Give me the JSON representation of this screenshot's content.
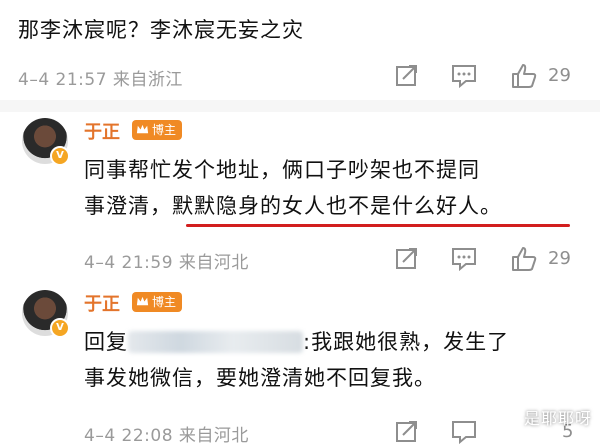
{
  "top_comment": {
    "text": "那李沐宸呢？李沐宸无妄之灾"
  },
  "row1": {
    "meta": "4–4 21:57  来自浙江",
    "likes": "29"
  },
  "reply1": {
    "user": "于正",
    "badge": "博主",
    "text_line1": "同事帮忙发个地址，俩口子吵架也不提同",
    "text_line2_a": "事澄清，",
    "text_line2_b": "默默隐身的女人也不是什么好人。",
    "meta": "4–4 21:59  来自河北",
    "likes": "29"
  },
  "reply2": {
    "user": "于正",
    "badge": "博主",
    "text_prefix": "回复",
    "text_suffix": ":我跟她很熟，发生了",
    "text_line2": "事发她微信，要她澄清她不回复我。",
    "meta": "4–4 22:08  来自河北",
    "likes": "5"
  },
  "watermark": "是耶耶呀",
  "colors": {
    "accent": "#e3742b",
    "underline": "#d21e1e",
    "meta": "#9a9a9a"
  }
}
